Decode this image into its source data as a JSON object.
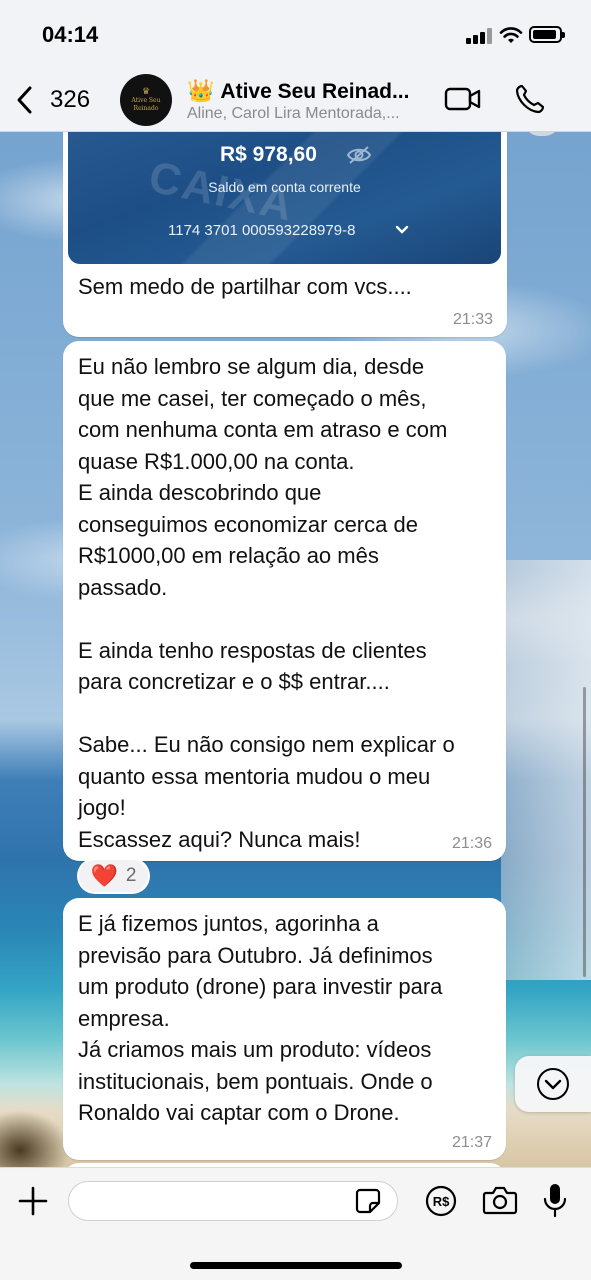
{
  "status_bar": {
    "time": "04:14"
  },
  "header": {
    "back_count": "326",
    "avatar_text": "Ative Seu Reinado",
    "title_emoji": "👑",
    "title": "Ative Seu Reinad...",
    "subtitle": "Aline, Carol Lira Mentorada,..."
  },
  "messages": [
    {
      "bank_card": {
        "balance": "R$ 978,60",
        "label": "Saldo em conta corrente",
        "account": "1174 3701 000593228979-8"
      },
      "text": "Sem medo de partilhar com vcs....",
      "time": "21:33"
    },
    {
      "text": "Eu não lembro se algum dia, desde\nque me casei, ter começado o mês,\ncom nenhuma conta em atraso e com\nquase R$1.000,00 na conta.\nE ainda descobrindo que\nconseguimos economizar cerca de\nR$1000,00 em relação ao mês\npassado.\n\nE ainda tenho respostas de clientes\npara concretizar e o $$ entrar....\n\nSabe... Eu não consigo nem explicar o\nquanto essa mentoria mudou o meu\njogo!\nEscassez aqui? Nunca mais!",
      "time": "21:36",
      "reaction": {
        "emoji": "❤️",
        "count": "2"
      }
    },
    {
      "text": "E já fizemos juntos, agorinha a\nprevisão para Outubro. Já definimos\num produto (drone) para investir para\nempresa.\nJá criamos mais um produto: vídeos\ninstitucionais, bem pontuais. Onde o\nRonaldo vai captar com o Drone.",
      "time": "21:37"
    }
  ],
  "input_bar": {
    "placeholder": ""
  },
  "colors": {
    "bubble": "#ffffff",
    "time_text": "#8d8d92",
    "bank_card": "#1d4f86",
    "reaction_heart": "#e5342f"
  }
}
